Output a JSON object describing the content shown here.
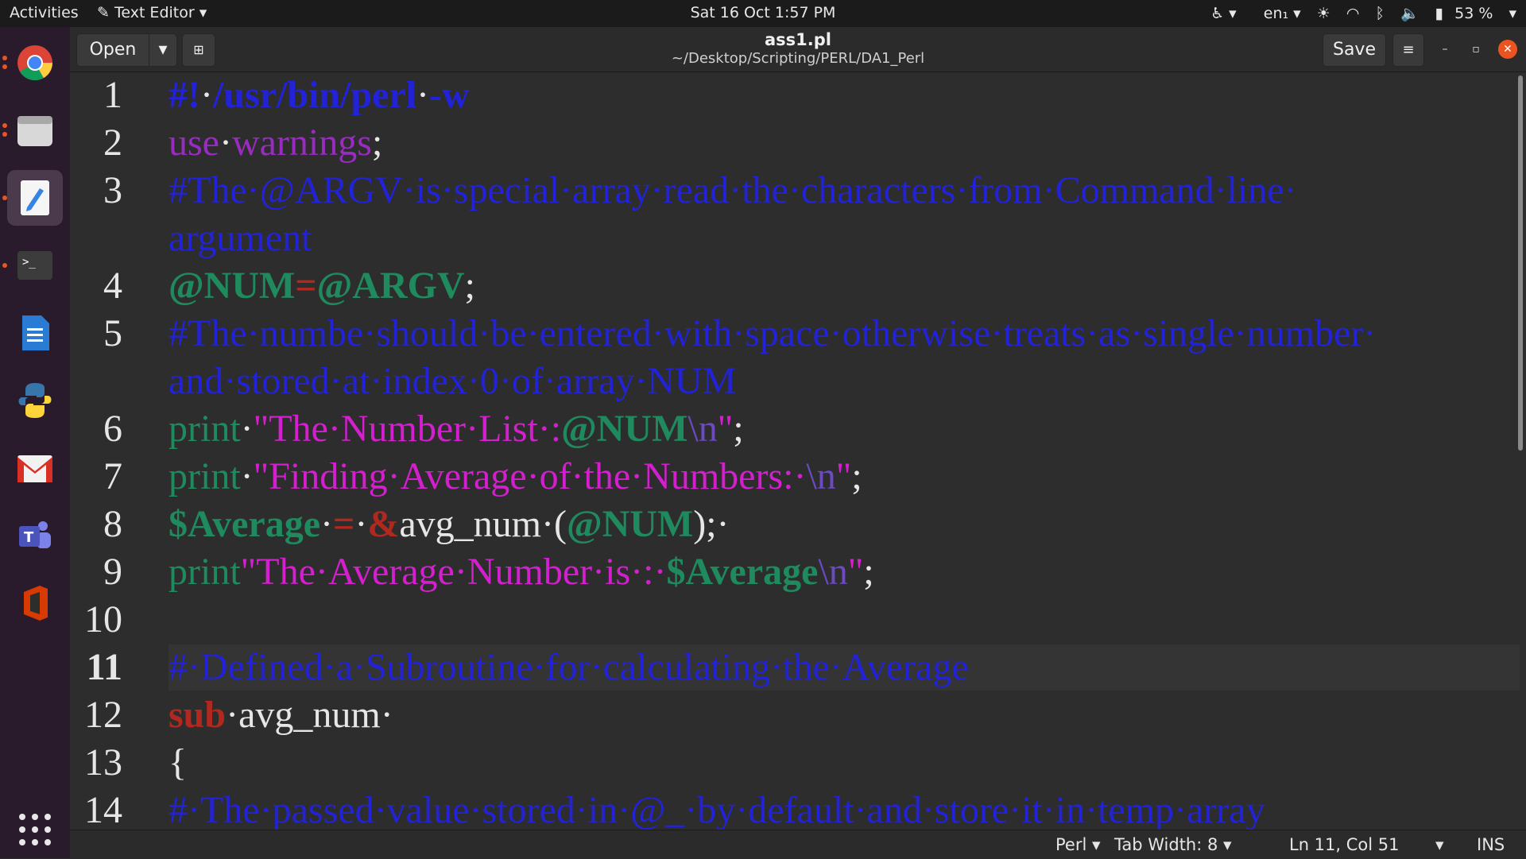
{
  "topbar": {
    "activities": "Activities",
    "app_menu": "Text Editor",
    "clock": "Sat 16 Oct  1:57 PM",
    "language": "en₁",
    "battery": "53 %"
  },
  "dock": {
    "apps": [
      "chrome",
      "files",
      "text-editor",
      "terminal",
      "libreoffice-writer",
      "python",
      "gmail",
      "teams",
      "office"
    ]
  },
  "header": {
    "open_label": "Open",
    "save_label": "Save",
    "title": "ass1.pl",
    "path": "~/Desktop/Scripting/PERL/DA1_Perl"
  },
  "editor": {
    "line_numbers": [
      "1",
      "2",
      "3",
      "4",
      "5",
      "6",
      "7",
      "8",
      "9",
      "10",
      "11",
      "12",
      "13",
      "14"
    ],
    "lines": [
      [
        {
          "t": "#!",
          "c": "shebang"
        },
        {
          "t": "·",
          "c": "plain"
        },
        {
          "t": "/usr/bin/perl",
          "c": "shebang"
        },
        {
          "t": "·",
          "c": "plain"
        },
        {
          "t": "-w",
          "c": "shebang"
        }
      ],
      [
        {
          "t": "use",
          "c": "use"
        },
        {
          "t": "·",
          "c": "plain"
        },
        {
          "t": "warnings",
          "c": "use"
        },
        {
          "t": ";",
          "c": "plain"
        }
      ],
      [
        {
          "t": "#The·@ARGV·is·special·array·read·the·characters·from·Command·line·",
          "c": "comment"
        }
      ],
      [
        {
          "t": "argument",
          "c": "comment"
        }
      ],
      [
        {
          "t": "@NUM",
          "c": "var"
        },
        {
          "t": "=",
          "c": "kw"
        },
        {
          "t": "@ARGV",
          "c": "var"
        },
        {
          "t": ";",
          "c": "plain"
        }
      ],
      [
        {
          "t": "#The·numbe·should·be·entered·with·space·otherwise·treats·as·single·number·",
          "c": "comment"
        }
      ],
      [
        {
          "t": "and·stored·at·index·0·of·array·NUM",
          "c": "comment"
        }
      ],
      [
        {
          "t": "print",
          "c": "func"
        },
        {
          "t": "·",
          "c": "plain"
        },
        {
          "t": "\"The·Number·List·:",
          "c": "str"
        },
        {
          "t": "@NUM",
          "c": "var"
        },
        {
          "t": "\\n",
          "c": "esc"
        },
        {
          "t": "\"",
          "c": "str"
        },
        {
          "t": ";",
          "c": "plain"
        }
      ],
      [
        {
          "t": "print",
          "c": "func"
        },
        {
          "t": "·",
          "c": "plain"
        },
        {
          "t": "\"Finding·Average·of·the·Numbers:·",
          "c": "str"
        },
        {
          "t": "\\n",
          "c": "esc"
        },
        {
          "t": "\"",
          "c": "str"
        },
        {
          "t": ";",
          "c": "plain"
        }
      ],
      [
        {
          "t": "$Average",
          "c": "var"
        },
        {
          "t": "·",
          "c": "plain"
        },
        {
          "t": "=",
          "c": "kw"
        },
        {
          "t": "·",
          "c": "plain"
        },
        {
          "t": "&",
          "c": "kw"
        },
        {
          "t": "avg_num",
          "c": "plain"
        },
        {
          "t": "·",
          "c": "plain"
        },
        {
          "t": "(",
          "c": "plain"
        },
        {
          "t": "@NUM",
          "c": "var"
        },
        {
          "t": ");·",
          "c": "plain"
        }
      ],
      [
        {
          "t": "print",
          "c": "func"
        },
        {
          "t": "\"The·Average·Number·is·:·",
          "c": "str"
        },
        {
          "t": "$Average",
          "c": "var"
        },
        {
          "t": "\\n",
          "c": "esc"
        },
        {
          "t": "\"",
          "c": "str"
        },
        {
          "t": ";",
          "c": "plain"
        }
      ],
      [],
      [
        {
          "t": "#·Defined·a·Subroutine·for·calculating·the·Average",
          "c": "comment"
        }
      ],
      [
        {
          "t": "sub",
          "c": "kw"
        },
        {
          "t": "·",
          "c": "plain"
        },
        {
          "t": "avg_num",
          "c": "plain"
        },
        {
          "t": "·",
          "c": "plain"
        }
      ],
      [
        {
          "t": "{",
          "c": "plain"
        }
      ],
      [
        {
          "t": "#·The·passed·value·stored·in·@_·by·default·and·store·it·in·temp·array",
          "c": "comment"
        }
      ]
    ],
    "row_line_map": [
      "1",
      "2",
      "3",
      "",
      "4",
      "5",
      "",
      "6",
      "7",
      "8",
      "9",
      "10",
      "11",
      "12",
      "13",
      "14"
    ]
  },
  "statusbar": {
    "language": "Perl",
    "tab_width": "Tab Width: 8",
    "position": "Ln 11, Col 51",
    "mode": "INS"
  }
}
